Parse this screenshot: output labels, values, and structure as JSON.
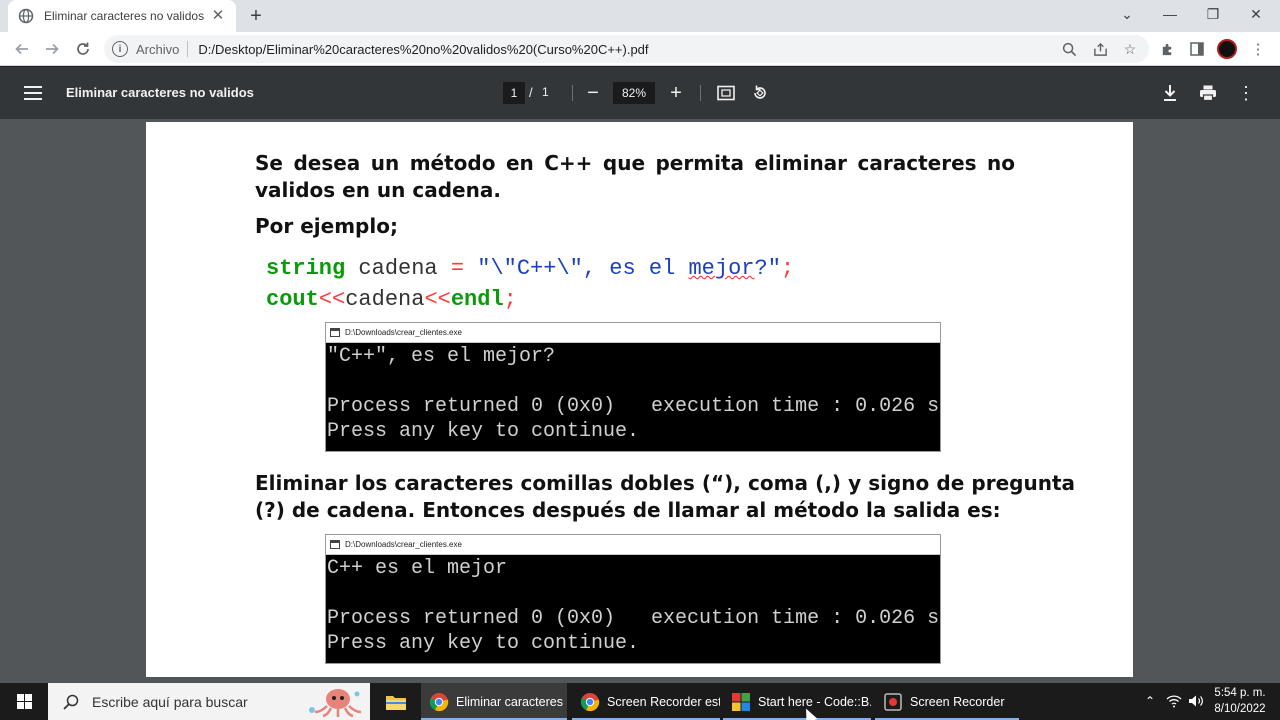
{
  "browser": {
    "tab_title": "Eliminar caracteres no validos",
    "scheme_label": "Archivo",
    "url": "D:/Desktop/Eliminar%20caracteres%20no%20validos%20(Curso%20C++).pdf"
  },
  "pdf_viewer": {
    "title": "Eliminar caracteres no validos",
    "current_page": "1",
    "page_separator": "/",
    "total_pages": "1",
    "zoom": "82%"
  },
  "document": {
    "intro": "Se desea un método en C++ que permita eliminar caracteres no validos en un cadena.",
    "example_label": "Por ejemplo;",
    "code": {
      "kw_string": "string",
      "var_cadena": "cadena",
      "op_assign": "=",
      "literal_start": "\"\\\"C++\\\", es el ",
      "literal_squiggle": "mejor",
      "literal_end": "?\"",
      "semicolon": ";",
      "kw_cout": "cout",
      "op_stream": "<<",
      "kw_endl": "endl"
    },
    "console1": {
      "title": "D:\\Downloads\\crear_clientes.exe",
      "output": "\"C++\", es el mejor?",
      "process": "Process returned 0 (0x0)   execution time : 0.026 s",
      "press": "Press any key to continue."
    },
    "instruction": "Eliminar los caracteres comillas dobles (“), coma (,) y signo de pregunta (?) de cadena. Entonces después de llamar al método la salida es:",
    "console2": {
      "title": "D:\\Downloads\\crear_clientes.exe",
      "output": "C++ es el mejor",
      "process": "Process returned 0 (0x0)   execution time : 0.026 s",
      "press": "Press any key to continue."
    }
  },
  "taskbar": {
    "search_placeholder": "Escribe aquí para buscar",
    "apps": [
      {
        "label": "Eliminar caracteres ...",
        "icon": "chrome-icon"
      },
      {
        "label": "Screen Recorder est...",
        "icon": "chrome-icon"
      },
      {
        "label": "Start here - Code::B...",
        "icon": "codeblocks-icon"
      },
      {
        "label": "Screen Recorder",
        "icon": "recorder-icon"
      }
    ],
    "time": "5:54 p. m.",
    "date": "8/10/2022"
  },
  "colors": {
    "code_keyword": "#0a9b0a",
    "code_operator": "#ff3c3c",
    "code_string": "#1a40c0",
    "pdf_toolbar": "#323639",
    "pdf_canvas": "#525659",
    "taskbar": "#1b1b1b"
  }
}
